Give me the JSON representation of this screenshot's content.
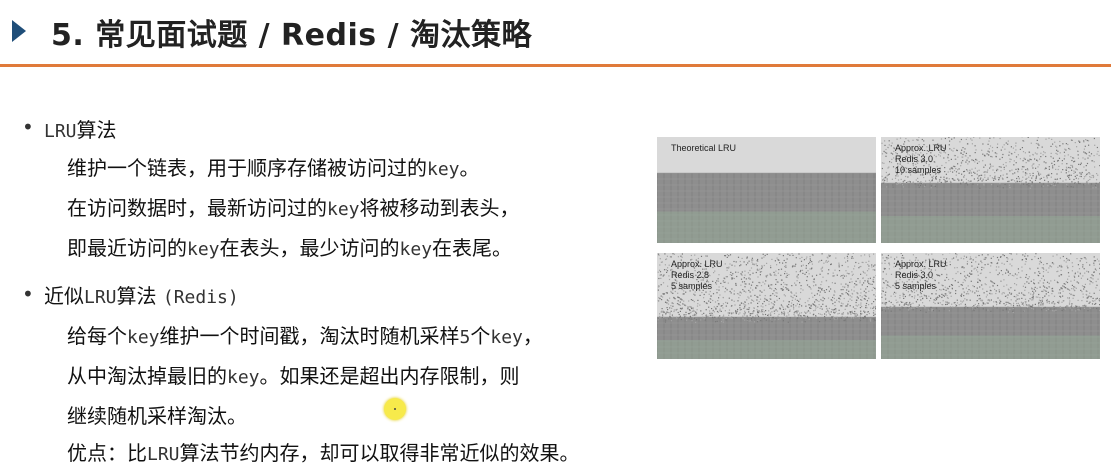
{
  "header": {
    "title": "5. 常见面试题 / Redis / 淘汰策略",
    "accent_color": "#e07a3a",
    "arrow_color": "#1f4e79"
  },
  "sections": [
    {
      "bullet": "•",
      "heading": {
        "a": "LRU",
        "b": "算法"
      },
      "lines": [
        [
          "维护一个链表，用于顺序存储被访问过的",
          "key",
          "。"
        ],
        [
          "在访问数据时，最新访问过的",
          "key",
          "将被移动到表头，"
        ],
        [
          "即最近访问的",
          "key",
          "在表头，最少访问的",
          "key",
          "在表尾。"
        ]
      ]
    },
    {
      "bullet": "•",
      "heading": {
        "a": "近似",
        "b": "LRU",
        "c": "算法 ",
        "d": "(Redis)"
      },
      "lines": [
        [
          "给每个",
          "key",
          "维护一个时间戳，淘汰时随机采样",
          "5",
          "个",
          "key",
          "，"
        ],
        [
          "从中淘汰掉最旧的",
          "key",
          "。如果还是超出内存限制，则"
        ],
        [
          "继续随机采样淘汰。"
        ],
        [
          "优点：比",
          "LRU",
          "算法节约内存，却可以取得非常近似的效果。"
        ]
      ]
    }
  ],
  "figure": {
    "panels": [
      {
        "lines": [
          "Theoretical LRU"
        ]
      },
      {
        "lines": [
          "Approx. LRU",
          "Redis 3.0",
          "10 samples"
        ]
      },
      {
        "lines": [
          "Approx. LRU",
          "Redis 2.8",
          "5 samples"
        ]
      },
      {
        "lines": [
          "Approx. LRU",
          "Redis 3.0",
          "5 samples"
        ]
      }
    ]
  }
}
